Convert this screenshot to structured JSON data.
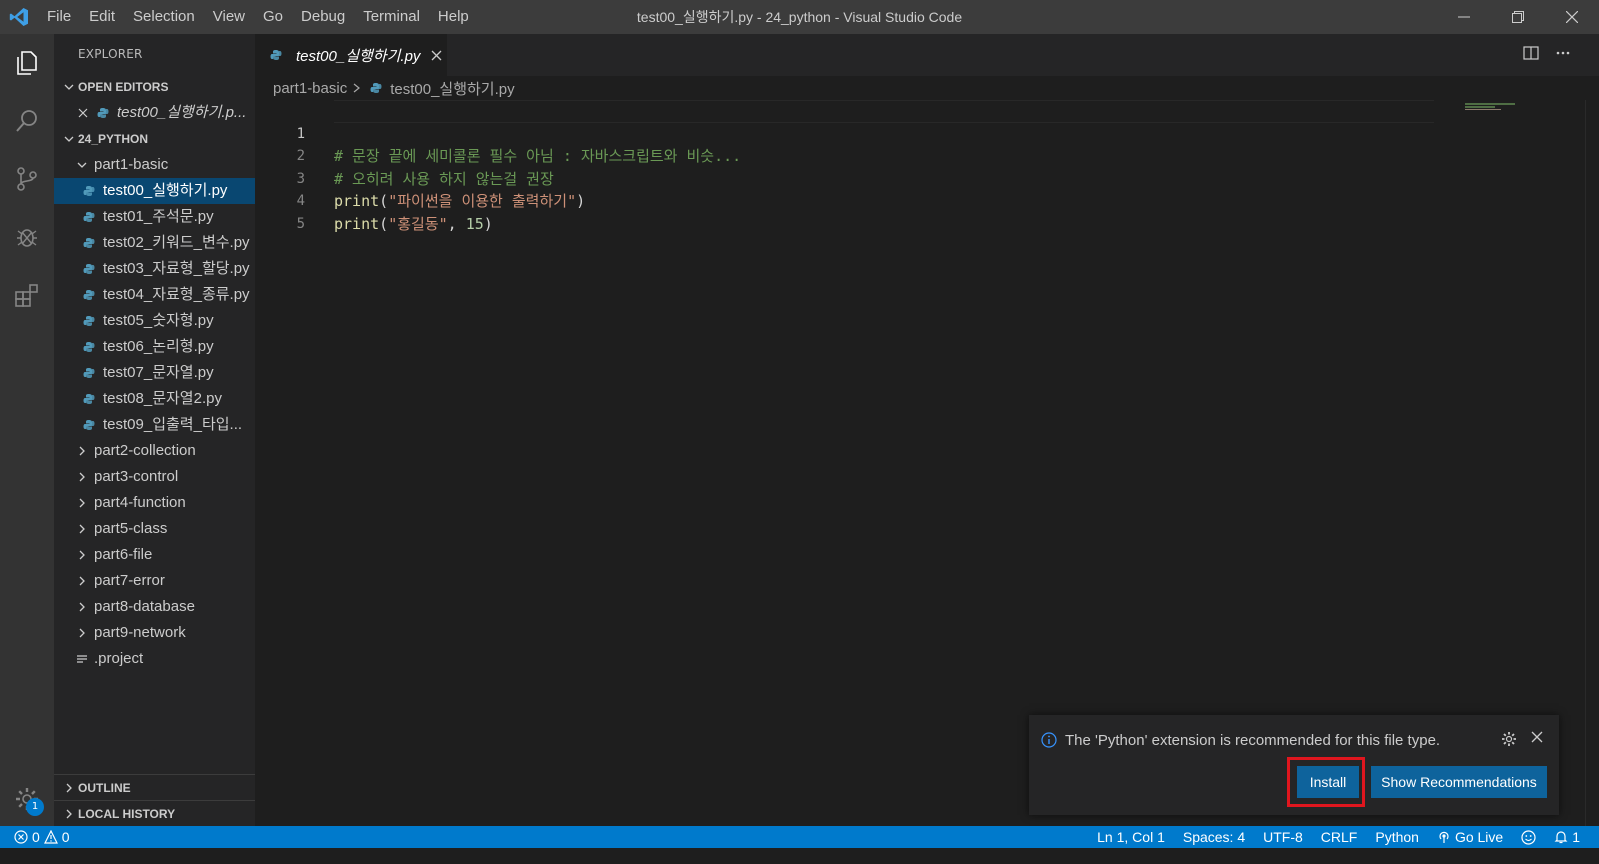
{
  "titlebar": {
    "title": "test00_실행하기.py - 24_python - Visual Studio Code",
    "menu": [
      "File",
      "Edit",
      "Selection",
      "View",
      "Go",
      "Debug",
      "Terminal",
      "Help"
    ]
  },
  "activitybar": {
    "icons": [
      "files-icon",
      "search-icon",
      "source-control-icon",
      "debug-icon",
      "extensions-icon"
    ],
    "manage_badge": "1"
  },
  "sidebar": {
    "title": "EXPLORER",
    "open_editors": {
      "label": "OPEN EDITORS",
      "items": [
        {
          "name": "test00_실행하기.p..."
        }
      ]
    },
    "project": {
      "label": "24_PYTHON",
      "folder": "part1-basic",
      "files": [
        "test00_실행하기.py",
        "test01_주석문.py",
        "test02_키워드_변수.py",
        "test03_자료형_할당.py",
        "test04_자료형_종류.py",
        "test05_숫자형.py",
        "test06_논리형.py",
        "test07_문자열.py",
        "test08_문자열2.py",
        "test09_입출력_타입..."
      ],
      "folders": [
        "part2-collection",
        "part3-control",
        "part4-function",
        "part5-class",
        "part6-file",
        "part7-error",
        "part8-database",
        "part9-network"
      ],
      "project_file": ".project"
    },
    "outline_label": "OUTLINE",
    "local_history_label": "LOCAL HISTORY"
  },
  "editor": {
    "tab_label": "test00_실행하기.py",
    "breadcrumb": {
      "folder": "part1-basic",
      "file": "test00_실행하기.py"
    },
    "lines": {
      "n1": "1",
      "n2": "2",
      "n3": "3",
      "n4": "4",
      "n5": "5",
      "l1": "# 문장 끝에 세미콜론 필수 아님 : 자바스크립트와 비슷...",
      "l2": "# 오히려 사용 하지 않는걸 권장",
      "l3_fn": "print",
      "l3_open": "(",
      "l3_str": "\"파이썬을 이용한 출력하기\"",
      "l3_close": ")",
      "l4_fn": "print",
      "l4_open": "(",
      "l4_str": "\"홍길동\"",
      "l4_comma": ", ",
      "l4_num": "15",
      "l4_close": ")"
    }
  },
  "notification": {
    "message": "The 'Python' extension is recommended for this file type.",
    "install_label": "Install",
    "recommendations_label": "Show Recommendations"
  },
  "statusbar": {
    "errors": "0",
    "warnings": "0",
    "position": "Ln 1, Col 1",
    "spaces": "Spaces: 4",
    "encoding": "UTF-8",
    "eol": "CRLF",
    "language": "Python",
    "golive": "Go Live",
    "notifications_count": "1"
  },
  "colors": {
    "accent": "#007acc",
    "selection": "#094771",
    "button": "#0e639c",
    "highlight_border": "#e0161e"
  }
}
